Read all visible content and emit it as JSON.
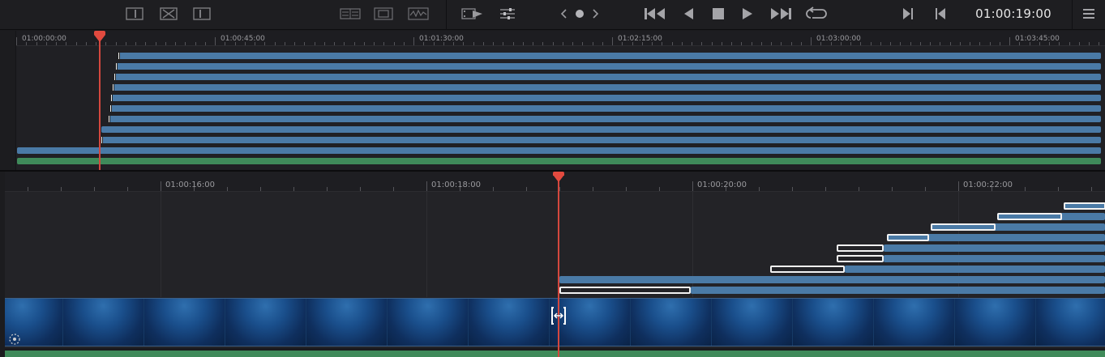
{
  "toolbar": {
    "left_icons": [
      "clip-trim-start-icon",
      "clip-dissolve-icon",
      "clip-trim-end-icon"
    ],
    "mid_icons": [
      "split-view-icon",
      "image-view-icon",
      "waveform-view-icon"
    ],
    "transport_icons": [
      "film-play-icon",
      "mixer-sliders-icon",
      "prev-edit-icon",
      "dot-icon",
      "next-edit-icon",
      "skip-to-start-icon",
      "play-reverse-icon",
      "stop-icon",
      "play-icon",
      "skip-to-end-icon",
      "loop-icon",
      "mark-out-icon",
      "mark-in-icon",
      "menu-icon"
    ],
    "timecode": "01:00:19:00"
  },
  "upper_timeline": {
    "ruler_labels": [
      "01:00:00:00",
      "01:00:45:00",
      "01:01:30:00",
      "01:02:15:00",
      "01:03:00:00",
      "01:03:45:00"
    ]
  },
  "lower_timeline": {
    "ruler_labels": [
      "01:00:16:00",
      "01:00:18:00",
      "01:00:20:00",
      "01:00:22:00"
    ]
  },
  "colors": {
    "clip_blue": "#4a7aa6",
    "audio_green": "#3f8a5a",
    "playhead_red": "#e24a3f"
  }
}
